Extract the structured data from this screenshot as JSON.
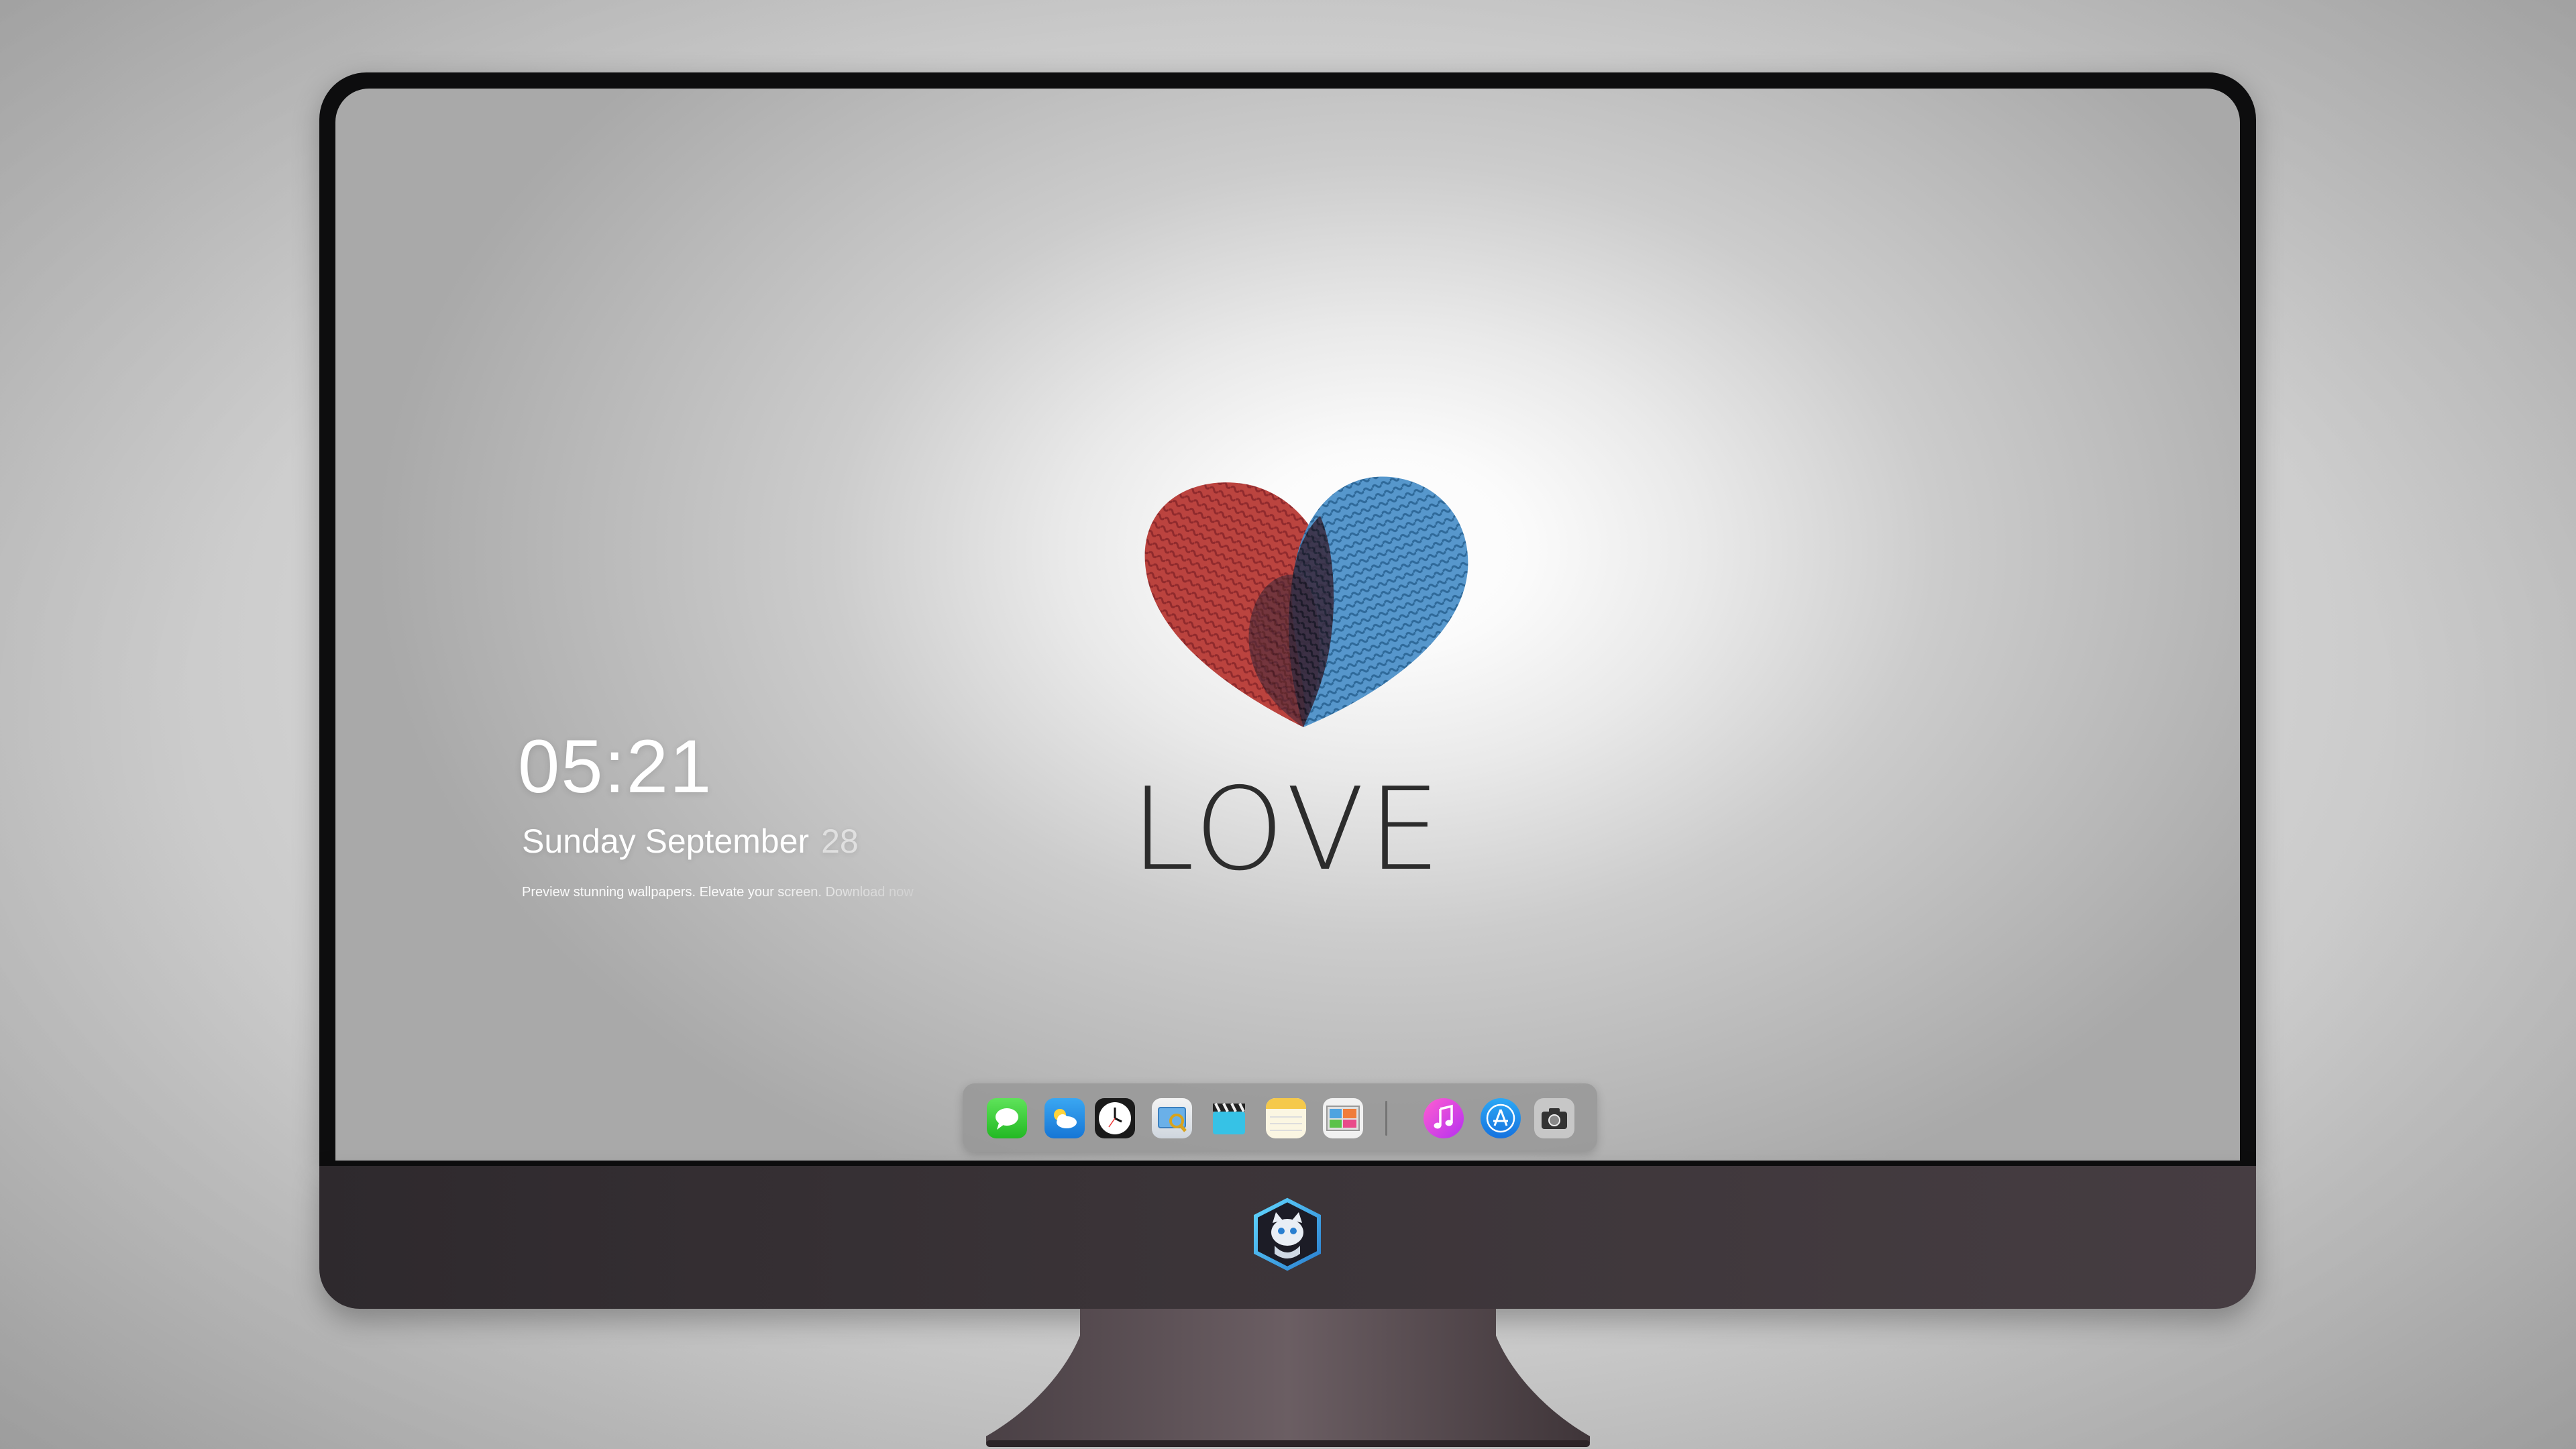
{
  "lockscreen": {
    "time": "05:21",
    "date_text": "Sunday September",
    "day_number": "28",
    "tagline": "Preview stunning wallpapers. Elevate your screen. Download now"
  },
  "wallpaper": {
    "headline": "LOVE",
    "heart_colors": [
      "#c0392b",
      "#3b87c4",
      "#2a2a3a"
    ]
  },
  "dock": {
    "items": [
      {
        "icon": "messages-icon"
      },
      {
        "icon": "weather-icon"
      },
      {
        "icon": "clock-icon"
      },
      {
        "icon": "preview-icon"
      },
      {
        "icon": "clapper-icon"
      },
      {
        "icon": "notes-icon"
      },
      {
        "icon": "photo-icon"
      },
      {
        "icon": "music-icon"
      },
      {
        "icon": "app-store-icon"
      },
      {
        "icon": "camera-icon"
      }
    ]
  },
  "brand": {
    "icon": "cat-mascot-icon"
  }
}
